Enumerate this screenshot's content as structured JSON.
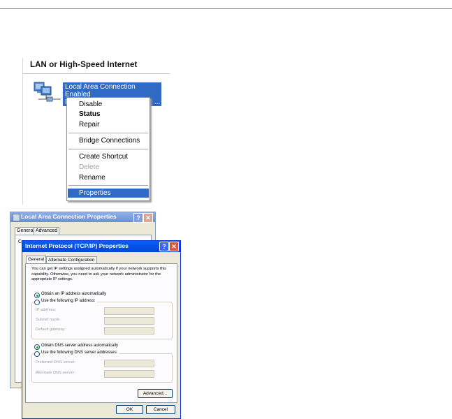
{
  "network": {
    "header": "LAN or High-Speed Internet",
    "connection": {
      "name": "Local Area Connection",
      "status": "Enabled",
      "line3_head": "I",
      "line3_tail": "..."
    },
    "context_menu": {
      "items": [
        {
          "label": "Disable"
        },
        {
          "label": "Status"
        },
        {
          "label": "Repair"
        },
        {
          "label": "Bridge Connections"
        },
        {
          "label": "Create Shortcut"
        },
        {
          "label": "Delete"
        },
        {
          "label": "Rename"
        },
        {
          "label": "Properties"
        }
      ]
    }
  },
  "props_window": {
    "title": "Local Area Connection Properties",
    "help": "?",
    "close": "✕",
    "tabs": [
      "General",
      "Advanced"
    ],
    "partial_text": "C"
  },
  "tcp_window": {
    "title": "Internet Protocol (TCP/IP) Properties",
    "help": "?",
    "close": "✕",
    "tabs": [
      "General",
      "Alternate Configuration"
    ],
    "description": "You can get IP settings assigned automatically if your network supports this capability. Otherwise, you need to ask your network administrator for the appropriate IP settings.",
    "ip_auto": "Obtain an IP address automatically",
    "ip_manual": "Use the following IP address:",
    "ip_fields": [
      "IP address:",
      "Subnet mask:",
      "Default gateway:"
    ],
    "dns_auto": "Obtain DNS server address automatically",
    "dns_manual": "Use the following DNS server addresses:",
    "dns_fields": [
      "Preferred DNS server:",
      "Alternate DNS server:"
    ],
    "advanced_button": "Advanced...",
    "ok_button": "OK",
    "cancel_button": "Cancel"
  },
  "colors": {
    "selection": "#316ac5",
    "xp_title_blue": "#0a5ef5",
    "dialog_bg": "#ece9d8"
  }
}
